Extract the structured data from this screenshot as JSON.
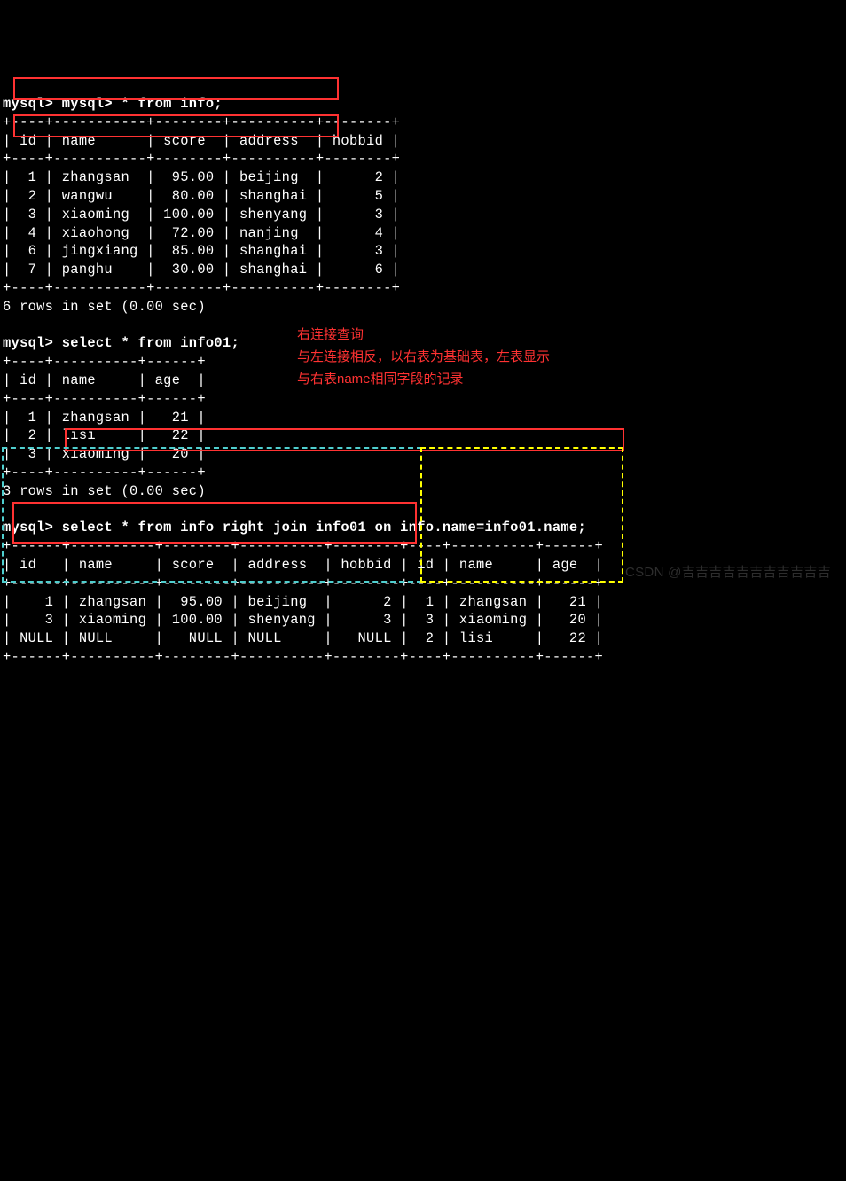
{
  "line01": "mysql> mysql> * from info;",
  "line02": "+----+-----------+--------+----------+--------+",
  "line03": "| id | name      | score  | address  | hobbid |",
  "line04": "+----+-----------+--------+----------+--------+",
  "line05": "|  1 | zhangsan  |  95.00 | beijing  |      2 |",
  "line06": "|  2 | wangwu    |  80.00 | shanghai |      5 |",
  "line07": "|  3 | xiaoming  | 100.00 | shenyang |      3 |",
  "line08": "|  4 | xiaohong  |  72.00 | nanjing  |      4 |",
  "line09": "|  6 | jingxiang |  85.00 | shanghai |      3 |",
  "line10": "|  7 | panghu    |  30.00 | shanghai |      6 |",
  "line11": "+----+-----------+--------+----------+--------+",
  "line12": "6 rows in set (0.00 sec)",
  "line13": "",
  "line14": "mysql> select * from info01;",
  "line15": "+----+----------+------+",
  "line16": "| id | name     | age  |",
  "line17": "+----+----------+------+",
  "line18": "|  1 | zhangsan |   21 |",
  "line19": "|  2 | lisi     |   22 |",
  "line20": "|  3 | xiaoming |   20 |",
  "line21": "+----+----------+------+",
  "line22": "3 rows in set (0.00 sec)",
  "line23": "",
  "line24": "mysql> select * from info right join info01 on info.name=info01.name;",
  "line25": "+------+----------+--------+----------+--------+----+----------+------+",
  "line26": "| id   | name     | score  | address  | hobbid | id | name     | age  |",
  "line27": "+------+----------+--------+----------+--------+----+----------+------+",
  "line28": "|    1 | zhangsan |  95.00 | beijing  |      2 |  1 | zhangsan |   21 |",
  "line29": "|    3 | xiaoming | 100.00 | shenyang |      3 |  3 | xiaoming |   20 |",
  "line30": "| NULL | NULL     |   NULL | NULL     |   NULL |  2 | lisi     |   22 |",
  "line31": "+------+----------+--------+----------+--------+----+----------+------+",
  "line32": "",
  "annot": {
    "title": "右连接查询",
    "line2": "与左连接相反，以右表为基础表，左表显示",
    "line3": "与右表name相同字段的记录"
  },
  "watermark": "CSDN @吉吉吉吉吉吉吉吉吉吉吉"
}
